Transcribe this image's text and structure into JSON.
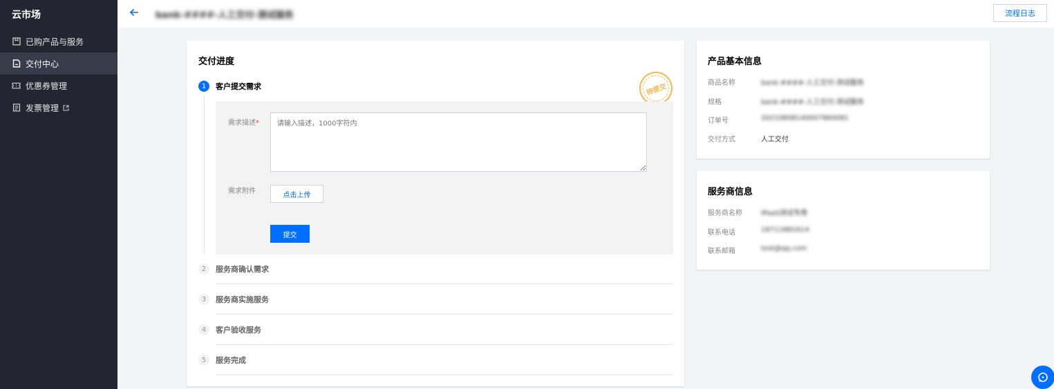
{
  "sidebar": {
    "brand": "云市场",
    "items": [
      {
        "label": "已购产品与服务",
        "icon": "box-icon"
      },
      {
        "label": "交付中心",
        "icon": "document-icon",
        "active": true
      },
      {
        "label": "优惠券管理",
        "icon": "coupon-icon"
      },
      {
        "label": "发票管理",
        "icon": "invoice-icon",
        "external_icon": "external-link-icon"
      }
    ]
  },
  "header": {
    "title": "bank-####-人工交付-测试服务",
    "flow_log": "流程日志"
  },
  "progress": {
    "title": "交付进度",
    "stamp": "待提交",
    "active_step": {
      "num": "1",
      "label": "客户提交需求"
    },
    "form": {
      "desc_label": "需求描述",
      "desc_required": "*",
      "desc_placeholder": "请输入描述，1000字符内",
      "attach_label": "需求附件",
      "upload_label": "点击上传",
      "submit_label": "提交"
    },
    "steps": [
      {
        "num": "2",
        "label": "服务商确认需求"
      },
      {
        "num": "3",
        "label": "服务商实施服务"
      },
      {
        "num": "4",
        "label": "客户验收服务"
      },
      {
        "num": "5",
        "label": "服务完成"
      }
    ]
  },
  "product_info": {
    "title": "产品基本信息",
    "rows": [
      {
        "key": "商品名称",
        "value": "bank-####-人工交付-测试服务"
      },
      {
        "key": "规格",
        "value": "bank-####-人工交付-测试服务"
      },
      {
        "key": "订单号",
        "value": "20210808140007860081"
      },
      {
        "key": "交付方式",
        "value": "人工交付"
      }
    ]
  },
  "vendor_info": {
    "title": "服务商信息",
    "rows": [
      {
        "key": "服务商名称",
        "value": "IPaaS测试专用"
      },
      {
        "key": "联系电话",
        "value": "18711881614"
      },
      {
        "key": "联系邮箱",
        "value": "test@qq.com"
      }
    ]
  },
  "colors": {
    "accent": "#006eff",
    "sidebar_bg": "#232630",
    "stamp": "#f5a623"
  }
}
